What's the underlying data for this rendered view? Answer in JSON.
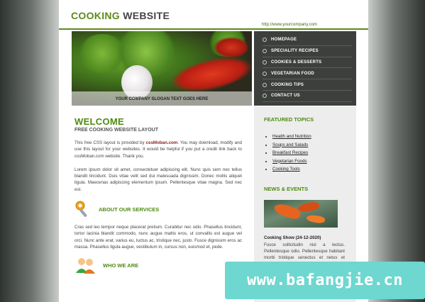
{
  "header": {
    "logo_part1": "COOKING",
    "logo_part2": "WEBSITE",
    "url": "http://www.yourcompany.com"
  },
  "hero": {
    "slogan": "YOUR COMPANY SLOGAN TEXT GOES HERE"
  },
  "nav": {
    "items": [
      {
        "label": "HOMEPAGE"
      },
      {
        "label": "SPECIALITY RECIPES"
      },
      {
        "label": "COOKIES & DESSERTS"
      },
      {
        "label": "VEGETARIAN FOOD"
      },
      {
        "label": "COOKING TIPS"
      },
      {
        "label": "CONTACT US"
      }
    ]
  },
  "main": {
    "title": "WELCOME",
    "subtitle": "FREE COOKING WEBSITE LAYOUT",
    "intro_before": "This free CSS layout is provided by ",
    "intro_link": "cssMoban.com",
    "intro_after": ". You may download, modify and use this layout for your websites. It would be helpful if you put a credit link back to cssMoban.com website. Thank you.",
    "para2": "Lorem ipsum dolor sit amet, consectetuer adipiscing elit. Nunc quis sem nec tellus blandit tincidunt. Duis vitae velit sed dui malesuada dignissim. Donec mollis aliquet ligula. Maecenas adipiscing elementum ipsum. Pellentesque vitae magna. Sed nec est.",
    "services_title": "ABOUT OUR SERVICES",
    "para3": "Cras sed leo tempor neque placerat pretium. Curabitur nec odio. Phasellus tincidunt, tortor lacinia blandit commodo, nunc augue mattis eros, ut convallis est augue vel orci. Nunc ante erat, varius eu, luctus ac, tristique nec, justo. Fusce dignissim eros ac massa. Phasellus ligula augue, vestibulum in, cursus non, euismod et, pede.",
    "who_title": "WHO WE ARE"
  },
  "sidebar": {
    "featured_title": "FEATURED TOPICS",
    "topics": [
      "Health and Nutrition",
      "Soups and Salads",
      "Breakfast Recipes",
      "Vegetarian Foods",
      "Cooking Tools"
    ],
    "news_title": "NEWS & EVENTS",
    "event_title": "Cooking Show (24-12-2020)",
    "event_text": "Fusce sollicitudin nisl a lectus. Pellentesque odio. Pellentesque habitant morbi tristique senectus et netus et malesuada"
  },
  "watermark": "www.bafangjie.cn",
  "colors": {
    "accent_green": "#4f8a10",
    "nav_bg": "#3c3f3b",
    "sidebar_bg": "#ecedec",
    "watermark_bg": "#6ed7cf"
  }
}
